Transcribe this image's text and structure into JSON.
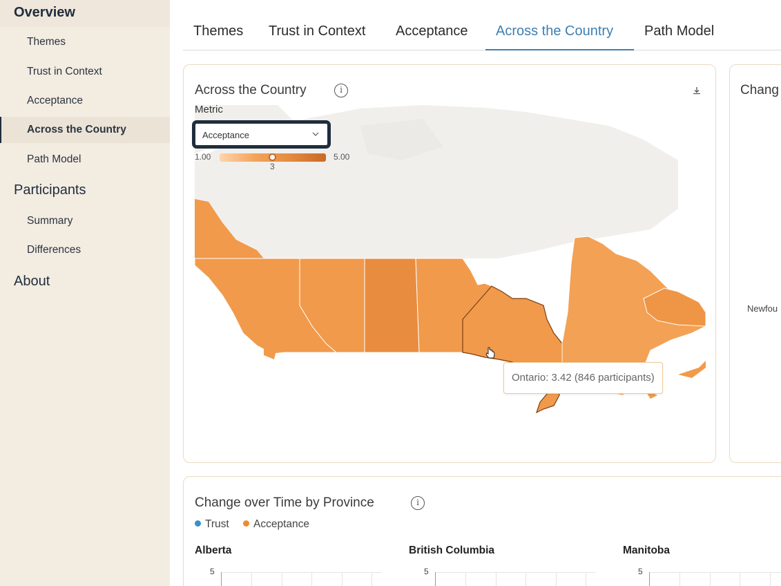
{
  "sidebar": {
    "overview": "Overview",
    "overview_items": [
      "Themes",
      "Trust in Context",
      "Acceptance",
      "Across the Country",
      "Path Model"
    ],
    "participants": "Participants",
    "participants_items": [
      "Summary",
      "Differences"
    ],
    "about": "About",
    "active_item": "Across the Country"
  },
  "tabs": [
    "Themes",
    "Trust in Context",
    "Acceptance",
    "Across the Country",
    "Path Model"
  ],
  "active_tab": "Across the Country",
  "map_card": {
    "title": "Across the Country",
    "metric_label": "Metric",
    "metric_value": "Acceptance",
    "scale_min": "1.00",
    "scale_max": "5.00",
    "scale_value": "3",
    "scale_position": 0.5,
    "tooltip": "Ontario: 3.42 (846 participants)",
    "icons": [
      "info-icon",
      "download-icon",
      "chevron-down-icon",
      "hand-cursor-icon"
    ]
  },
  "side_card": {
    "title_partial": "Chang",
    "label_partial": "Newfou"
  },
  "time_card": {
    "title": "Change over Time by Province",
    "legend": [
      {
        "label": "Trust",
        "color": "#3b8fc9"
      },
      {
        "label": "Acceptance",
        "color": "#f08a2c"
      }
    ],
    "panels": [
      {
        "title": "Alberta",
        "y_top": "5"
      },
      {
        "title": "British Columbia",
        "y_top": "5"
      },
      {
        "title": "Manitoba",
        "y_top": "5"
      }
    ]
  },
  "colors": {
    "sidebar_bg": "#f3ece1",
    "accent_blue": "#3d7fb0",
    "map_fill": "#f19a4b",
    "map_fill_dark": "#e88c3f",
    "card_border": "#ead9c3"
  }
}
